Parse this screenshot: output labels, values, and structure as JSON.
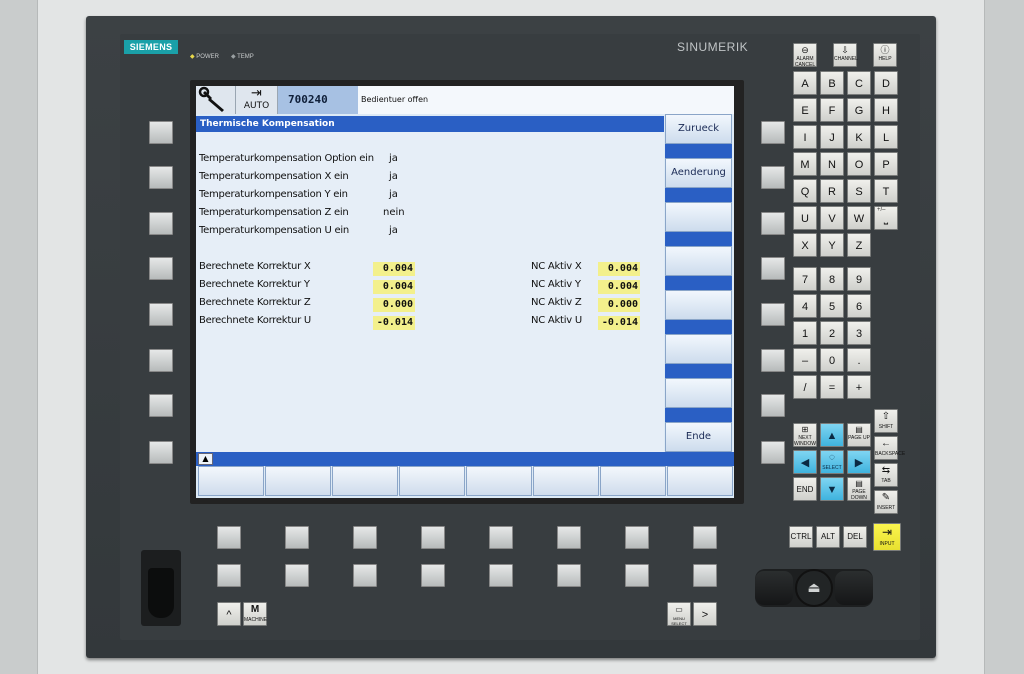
{
  "brand": {
    "logo": "SIEMENS",
    "model": "SINUMERIK",
    "led_power": "POWER",
    "led_temp": "TEMP"
  },
  "header": {
    "mode": "AUTO",
    "program": "700240",
    "message": "Bedientuer offen"
  },
  "window": {
    "title": "Thermische Kompensation"
  },
  "options": [
    {
      "label": "Temperaturkompensation Option ein",
      "value": "ja"
    },
    {
      "label": "Temperaturkompensation X ein",
      "value": "ja"
    },
    {
      "label": "Temperaturkompensation Y ein",
      "value": "ja"
    },
    {
      "label": "Temperaturkompensation Z ein",
      "value": "nein"
    },
    {
      "label": "Temperaturkompensation U ein",
      "value": "ja"
    }
  ],
  "corrections": [
    {
      "label": "Berechnete Korrektur X",
      "value": "0.004",
      "nc_label": "NC Aktiv X",
      "nc_value": "0.004"
    },
    {
      "label": "Berechnete Korrektur Y",
      "value": "0.004",
      "nc_label": "NC Aktiv Y",
      "nc_value": "0.004"
    },
    {
      "label": "Berechnete Korrektur Z",
      "value": "0.000",
      "nc_label": "NC Aktiv Z",
      "nc_value": "0.000"
    },
    {
      "label": "Berechnete Korrektur U",
      "value": "-0.014",
      "nc_label": "NC Aktiv U",
      "nc_value": "-0.014"
    }
  ],
  "vertical_softkeys": {
    "sk1": "Zurueck",
    "sk2": "Aenderung",
    "sk8": "Ende"
  },
  "keyboard": {
    "top": [
      "ALARM CANCEL",
      "CHANNEL",
      "HELP"
    ],
    "letters": [
      [
        "A",
        "B",
        "C",
        "D"
      ],
      [
        "E",
        "F",
        "G",
        "H"
      ],
      [
        "I",
        "J",
        "K",
        "L"
      ],
      [
        "M",
        "N",
        "O",
        "P"
      ],
      [
        "Q",
        "R",
        "S",
        "T"
      ],
      [
        "U",
        "V",
        "W"
      ],
      [
        "X",
        "Y",
        "Z"
      ]
    ],
    "space_label": "+/–",
    "digits": [
      [
        "7",
        "8",
        "9"
      ],
      [
        "4",
        "5",
        "6"
      ],
      [
        "1",
        "2",
        "3"
      ],
      [
        "–",
        "0",
        "."
      ],
      [
        "/",
        "=",
        "+"
      ]
    ],
    "nav": {
      "next_window": "NEXT WINDOW",
      "page_up": "PAGE UP",
      "select": "SELECT",
      "end": "END",
      "page_down": "PAGE DOWN",
      "shift": "SHIFT",
      "backspace": "BACKSPACE",
      "tab": "TAB",
      "insert": "INSERT",
      "input": "INPUT"
    },
    "modifiers": [
      "CTRL",
      "ALT",
      "DEL"
    ]
  },
  "bottom_keys": {
    "machine": "MACHINE",
    "menu_select": "MENU SELECT",
    "up_symbol": "^",
    "machine_symbol": "M",
    "next_symbol": ">"
  }
}
